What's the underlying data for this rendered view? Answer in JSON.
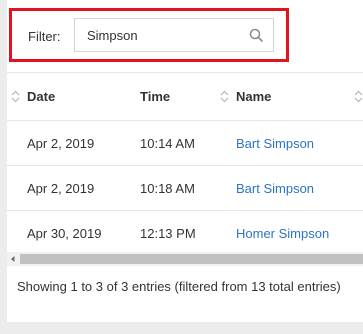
{
  "filter": {
    "label": "Filter:",
    "value": "Simpson",
    "icon": "search-icon"
  },
  "table": {
    "columns": [
      "Date",
      "Time",
      "Name"
    ],
    "rows": [
      {
        "date": "Apr 2, 2019",
        "time": "10:14 AM",
        "name": "Bart Simpson"
      },
      {
        "date": "Apr 2, 2019",
        "time": "10:18 AM",
        "name": "Bart Simpson"
      },
      {
        "date": "Apr 30, 2019",
        "time": "12:13 PM",
        "name": "Homer Simpson"
      }
    ]
  },
  "info": "Showing 1 to 3 of 3 entries (filtered from 13 total entries)",
  "colors": {
    "highlight": "#e0131f",
    "link": "#2f73c5"
  }
}
